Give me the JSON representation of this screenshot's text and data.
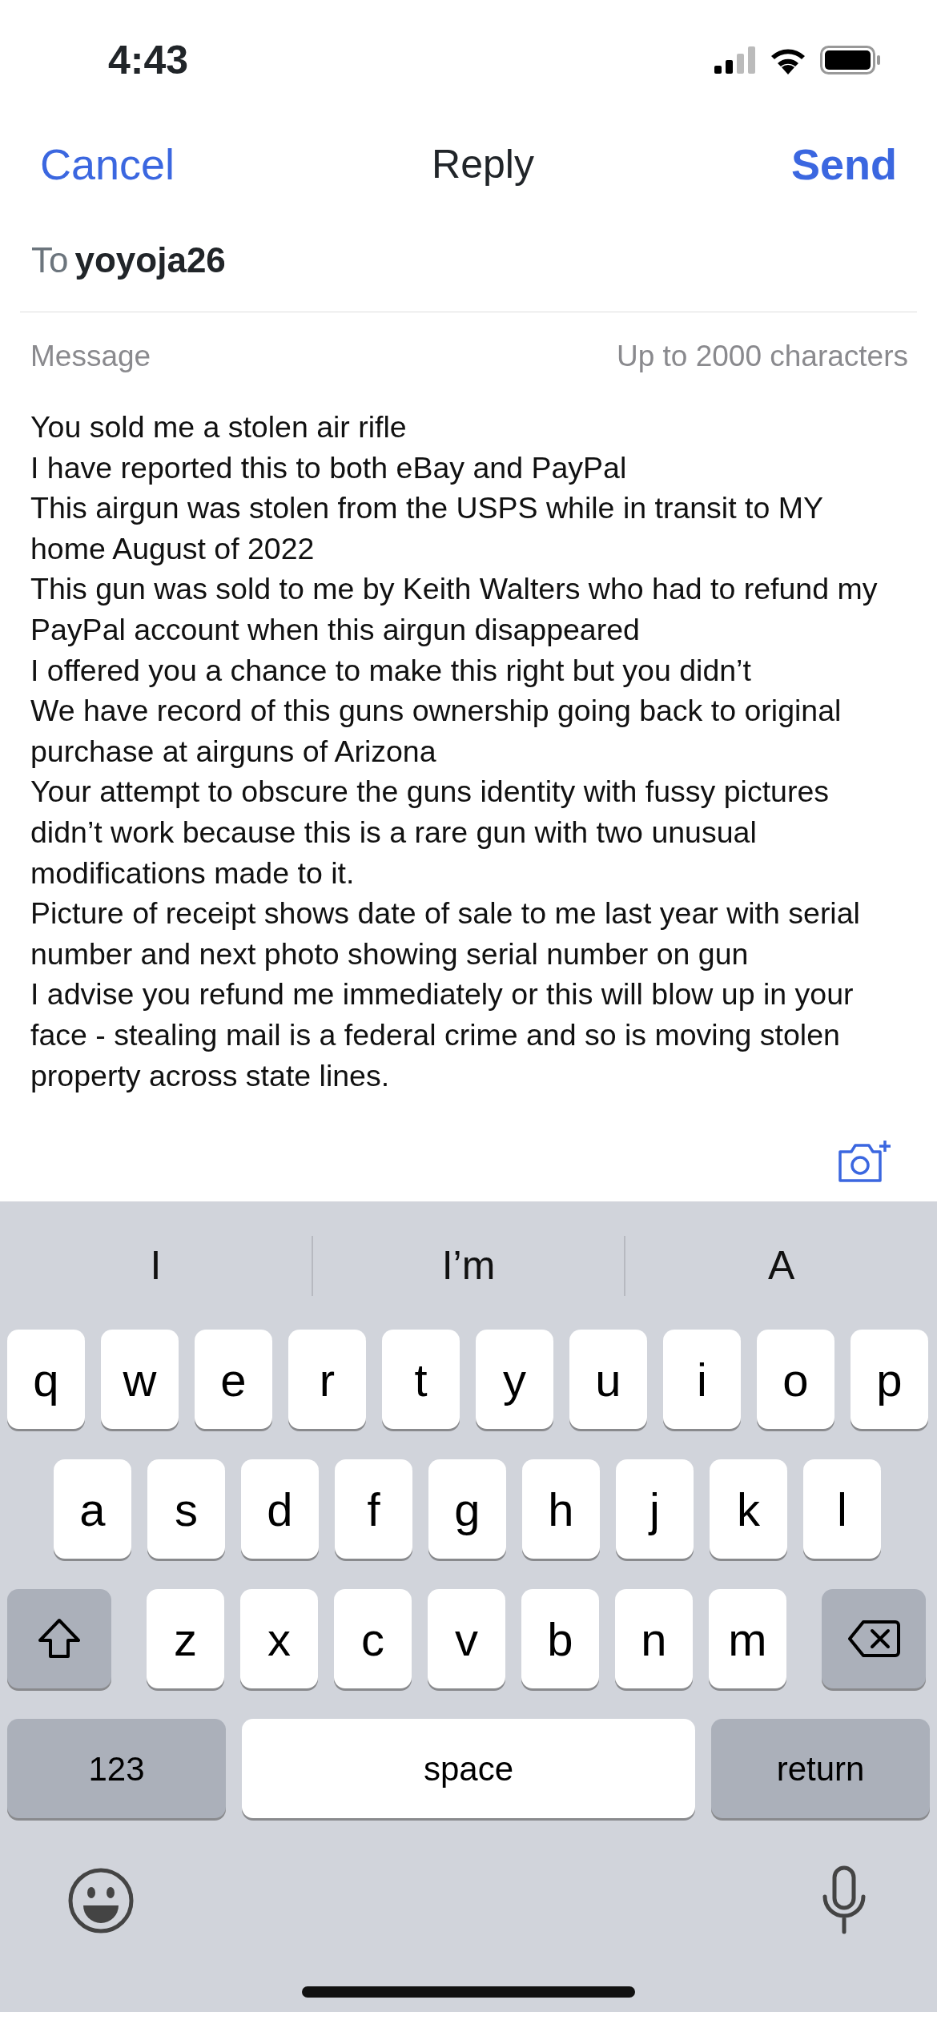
{
  "status_bar": {
    "time": "4:43"
  },
  "nav": {
    "cancel": "Cancel",
    "title": "Reply",
    "send": "Send"
  },
  "to": {
    "label": "To",
    "value": "yoyoja26"
  },
  "message": {
    "label": "Message",
    "limit": "Up to 2000 characters",
    "paragraphs": [
      "You sold me a stolen air rifle",
      "I have reported this to both eBay and PayPal",
      "This airgun was stolen from the USPS while in transit to MY home August of 2022",
      "This gun was sold to me by Keith Walters who had to refund my PayPal account when this airgun disappeared",
      "I offered you a chance to make this right but you didn’t",
      "We have record of this guns ownership going back to original purchase at airguns of Arizona",
      "Your attempt to obscure the guns identity with fussy pictures didn’t work because this is a rare gun with two unusual modifications made to it.",
      "Picture of receipt shows date of sale to me last year with serial number and next photo showing serial number on gun",
      "I advise you refund me immediately or this will blow up in your face - stealing mail is a federal crime and so is moving stolen property across state lines."
    ]
  },
  "keyboard": {
    "suggestions": [
      "I",
      "I’m",
      "A"
    ],
    "rows": [
      [
        {
          "kind": "letter",
          "label": "q"
        },
        {
          "kind": "letter",
          "label": "w"
        },
        {
          "kind": "letter",
          "label": "e"
        },
        {
          "kind": "letter",
          "label": "r"
        },
        {
          "kind": "letter",
          "label": "t"
        },
        {
          "kind": "letter",
          "label": "y"
        },
        {
          "kind": "letter",
          "label": "u"
        },
        {
          "kind": "letter",
          "label": "i"
        },
        {
          "kind": "letter",
          "label": "o"
        },
        {
          "kind": "letter",
          "label": "p"
        }
      ],
      [
        {
          "kind": "letter",
          "label": "a"
        },
        {
          "kind": "letter",
          "label": "s"
        },
        {
          "kind": "letter",
          "label": "d"
        },
        {
          "kind": "letter",
          "label": "f"
        },
        {
          "kind": "letter",
          "label": "g"
        },
        {
          "kind": "letter",
          "label": "h"
        },
        {
          "kind": "letter",
          "label": "j"
        },
        {
          "kind": "letter",
          "label": "k"
        },
        {
          "kind": "letter",
          "label": "l"
        }
      ],
      [
        {
          "kind": "shift"
        },
        {
          "kind": "letter",
          "label": "z"
        },
        {
          "kind": "letter",
          "label": "x"
        },
        {
          "kind": "letter",
          "label": "c"
        },
        {
          "kind": "letter",
          "label": "v"
        },
        {
          "kind": "letter",
          "label": "b"
        },
        {
          "kind": "letter",
          "label": "n"
        },
        {
          "kind": "letter",
          "label": "m"
        },
        {
          "kind": "delete"
        }
      ]
    ],
    "bottom_keys": {
      "numbers": "123",
      "space": "space",
      "return": "return"
    }
  }
}
